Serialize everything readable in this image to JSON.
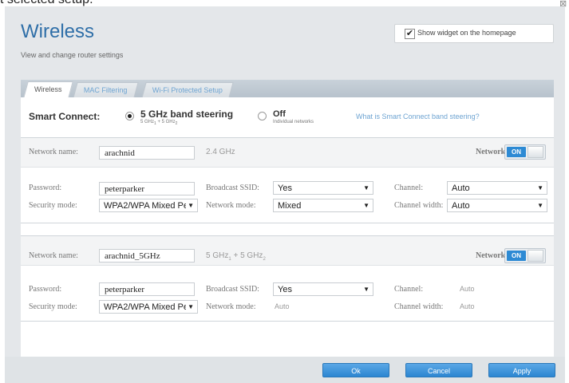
{
  "window": {
    "top_partial_text": "t selected setup.",
    "close_icon": "close-icon"
  },
  "header": {
    "title": "Wireless",
    "subtitle": "View and change router settings",
    "widget_checkbox_checked": true,
    "widget_label": "Show widget on the homepage"
  },
  "tabs": [
    {
      "label": "Wireless",
      "active": true
    },
    {
      "label": "MAC Filtering",
      "active": false
    },
    {
      "label": "Wi-Fi Protected Setup",
      "active": false
    }
  ],
  "smart_connect": {
    "label": "Smart Connect:",
    "option1_label": "5 GHz band steering",
    "option1_sub": "5 GHz1 + 5 GHz2",
    "option1_selected": true,
    "option2_label": "Off",
    "option2_sub": "Individual networks",
    "option2_selected": false,
    "help_link": "What is Smart Connect band steering?"
  },
  "network1": {
    "name_label": "Network name:",
    "name_value": "arachnid",
    "band": "2.4 GHz",
    "network_label": "Network:",
    "toggle": "ON",
    "password_label": "Password:",
    "password_value": "peterparker",
    "broadcast_label": "Broadcast SSID:",
    "broadcast_value": "Yes",
    "channel_label": "Channel:",
    "channel_value": "Auto",
    "security_label": "Security mode:",
    "security_value": "WPA2/WPA Mixed Pe",
    "mode_label": "Network mode:",
    "mode_value": "Mixed",
    "width_label": "Channel width:",
    "width_value": "Auto"
  },
  "network2": {
    "name_label": "Network name:",
    "name_value": "arachnid_5GHz",
    "band": "5 GHz1 + 5 GHz2",
    "network_label": "Network:",
    "toggle": "ON",
    "password_label": "Password:",
    "password_value": "peterparker",
    "broadcast_label": "Broadcast SSID:",
    "broadcast_value": "Yes",
    "channel_label": "Channel:",
    "channel_value": "Auto",
    "security_label": "Security mode:",
    "security_value": "WPA2/WPA Mixed Pe",
    "mode_label": "Network mode:",
    "mode_value": "Auto",
    "width_label": "Channel width:",
    "width_value": "Auto"
  },
  "footer": {
    "ok_label": "Ok",
    "cancel_label": "Cancel",
    "apply_label": "Apply"
  },
  "colors": {
    "accent": "#2d8ad4",
    "title": "#2f6fa8",
    "link": "#6ea4d2"
  }
}
